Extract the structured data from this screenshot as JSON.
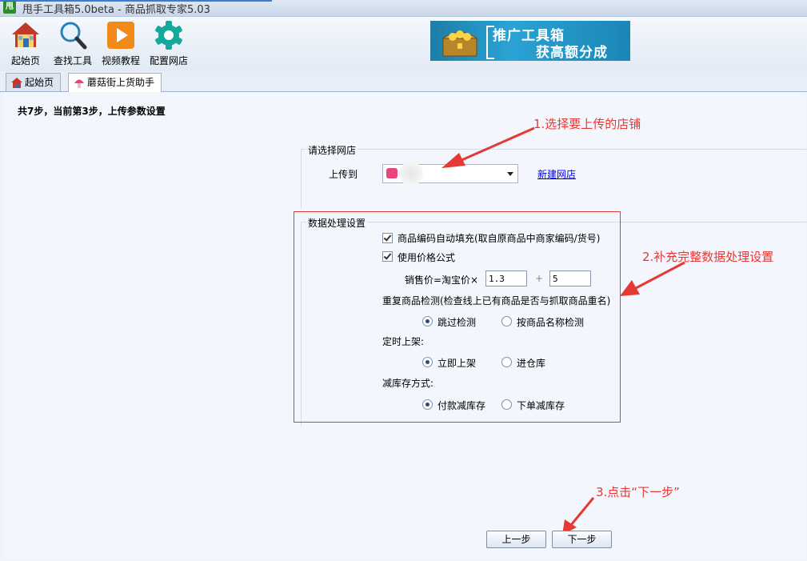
{
  "window": {
    "app_badge": "甩",
    "title": "甩手工具箱5.0beta - 商品抓取专家5.03"
  },
  "toolbar": {
    "items": [
      {
        "label": "起始页",
        "icon": "home-icon"
      },
      {
        "label": "查找工具",
        "icon": "magnifier-icon"
      },
      {
        "label": "视频教程",
        "icon": "play-icon"
      },
      {
        "label": "配置网店",
        "icon": "gear-icon"
      }
    ],
    "promo": {
      "line1": "推广工具箱",
      "line2": "获高额分成"
    }
  },
  "tabs": [
    {
      "label": "起始页",
      "icon": "home-icon",
      "active": false
    },
    {
      "label": "蘑菇街上货助手",
      "icon": "mushroom-icon",
      "active": true
    }
  ],
  "step_text": "共7步，当前第3步，上传参数设置",
  "shop_section": {
    "title": "请选择网店",
    "upload_label": "上传到",
    "selected_shop": "",
    "new_shop_link": "新建网店"
  },
  "data_section": {
    "title": "数据处理设置",
    "autofill": {
      "label": "商品编码自动填充(取自原商品中商家编码/货号)",
      "checked": true
    },
    "price_formula": {
      "label": "使用价格公式",
      "checked": true
    },
    "price_row": {
      "label": "销售价=淘宝价×",
      "multiplier": "1.3",
      "plus": "+",
      "addend": "5"
    },
    "duplicate": {
      "label": "重复商品检测(检查线上已有商品是否与抓取商品重名)",
      "options": [
        {
          "label": "跳过检测",
          "selected": true
        },
        {
          "label": "按商品名称检测",
          "selected": false
        }
      ]
    },
    "schedule": {
      "label": "定时上架:",
      "options": [
        {
          "label": "立即上架",
          "selected": true
        },
        {
          "label": "进仓库",
          "selected": false
        }
      ]
    },
    "stock": {
      "label": "减库存方式:",
      "options": [
        {
          "label": "付款减库存",
          "selected": true
        },
        {
          "label": "下单减库存",
          "selected": false
        }
      ]
    }
  },
  "annotations": {
    "a1": "1.选择要上传的店铺",
    "a2": "2.补充完整数据处理设置",
    "a3": "3.点击“下一步”",
    "color": "#e53935"
  },
  "buttons": {
    "prev": "上一步",
    "next": "下一步"
  }
}
